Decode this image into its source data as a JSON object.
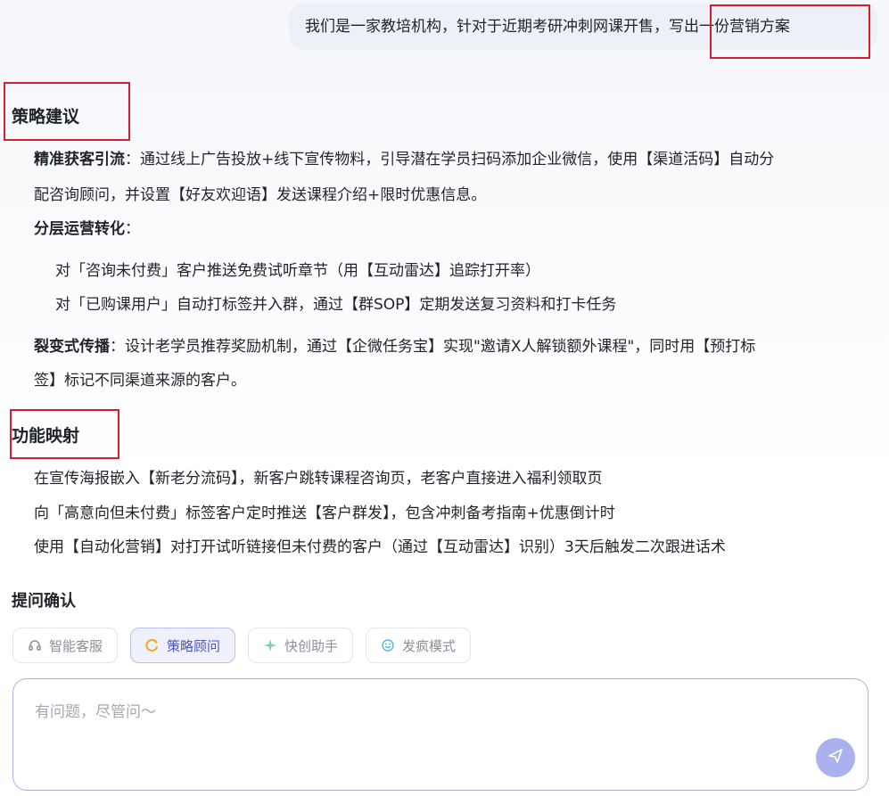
{
  "user_message": {
    "text_main": "我们是一家教培机构，针对于近期考研冲刺网课开售，",
    "text_highlight": "写出一份营销方案"
  },
  "strategy": {
    "heading": "策略建议",
    "item1_title": "精准获客引流",
    "item1_line1": "：通过线上广告投放+线下宣传物料，引导潜在学员扫码添加企业微信，使用【渠道活码】自动分",
    "item1_line2": "配咨询顾问，并设置【好友欢迎语】发送课程介绍+限时优惠信息。",
    "item2_title": "分层运营转化",
    "item2_colon": "：",
    "item2_sub1": "对「咨询未付费」客户推送免费试听章节（用【互动雷达】追踪打开率）",
    "item2_sub2": "对「已购课用户」自动打标签并入群，通过【群SOP】定期发送复习资料和打卡任务",
    "item3_title": "裂变式传播",
    "item3_line1": "：设计老学员推荐奖励机制，通过【企微任务宝】实现\"邀请X人解锁额外课程\"，同时用【预打标",
    "item3_line2": "签】标记不同渠道来源的客户。"
  },
  "mapping": {
    "heading": "功能映射",
    "line1": "在宣传海报嵌入【新老分流码】，新客户跳转课程咨询页，老客户直接进入福利领取页",
    "line2": "向「高意向但未付费」标签客户定时推送【客户群发】，包含冲刺备考指南+优惠倒计时",
    "line3": "使用【自动化营销】对打开试听链接但未付费的客户（通过【互动雷达】识别）3天后触发二次跟进话术"
  },
  "confirm": {
    "heading": "提问确认"
  },
  "modes": [
    {
      "label": "智能客服",
      "icon": "headset-icon"
    },
    {
      "label": "策略顾问",
      "icon": "strategy-icon"
    },
    {
      "label": "快创助手",
      "icon": "sparkle-icon"
    },
    {
      "label": "发疯模式",
      "icon": "crazy-icon"
    }
  ],
  "input": {
    "placeholder": "有问题，尽管问～"
  },
  "colors": {
    "accent": "#4b57c7",
    "highlight_box": "#d2202f",
    "send_button": "#a9b2ef"
  }
}
